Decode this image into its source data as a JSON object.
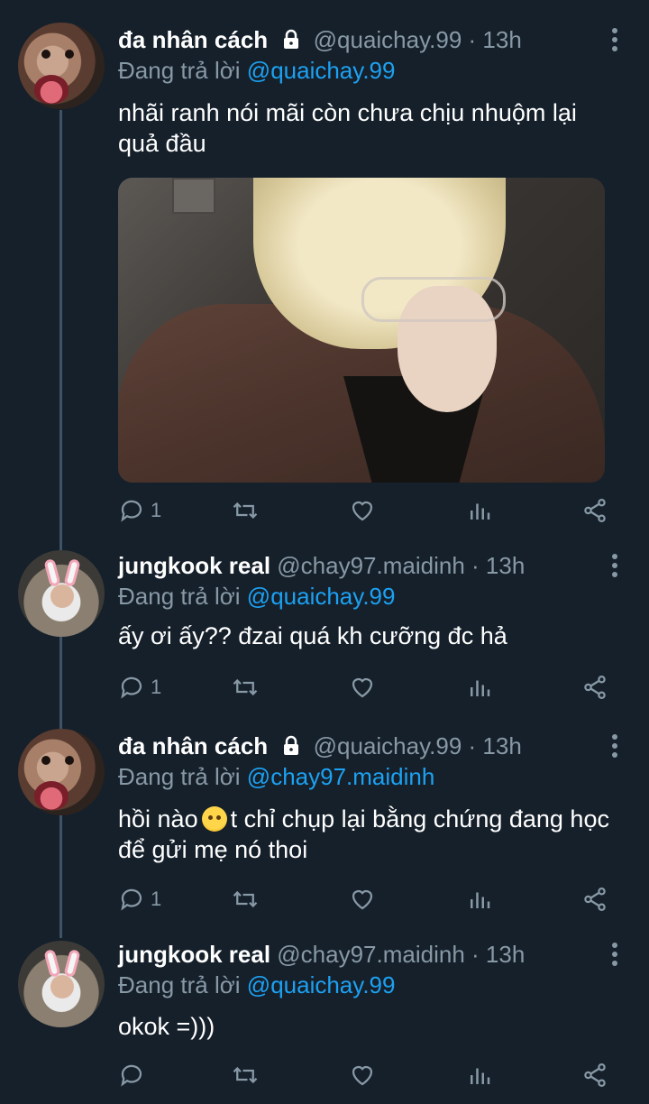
{
  "tweets": [
    {
      "name": "đa nhân cách",
      "locked": true,
      "handle": "@quaichay.99",
      "time": "· 13h",
      "reply_prefix": "Đang trả lời",
      "reply_to": "@quaichay.99",
      "text": "nhãi ranh nói mãi còn chưa chịu nhuộm lại quả đầu",
      "reply_count": "1"
    },
    {
      "name": "jungkook real",
      "locked": false,
      "handle": "@chay97.maidinh",
      "time": "· 13h",
      "reply_prefix": "Đang trả lời",
      "reply_to": "@quaichay.99",
      "text": "ấy ơi ấy?? đzai quá kh cưỡng đc hả",
      "reply_count": "1"
    },
    {
      "name": "đa nhân cách",
      "locked": true,
      "handle": "@quaichay.99",
      "time": "· 13h",
      "reply_prefix": "Đang trả lời",
      "reply_to": "@chay97.maidinh",
      "text_before_emoji": "hồi nào",
      "emoji": "angry-face-emoji",
      "text_after_emoji": "t chỉ chụp lại bằng chứng đang học để gửi mẹ nó thoi",
      "reply_count": "1"
    },
    {
      "name": "jungkook real",
      "locked": false,
      "handle": "@chay97.maidinh",
      "time": "· 13h",
      "reply_prefix": "Đang trả lời",
      "reply_to": "@quaichay.99",
      "text": "okok =)))",
      "reply_count": ""
    }
  ],
  "icons": {
    "reply": "reply-icon",
    "retweet": "retweet-icon",
    "like": "heart-icon",
    "analytics": "analytics-icon",
    "share": "share-icon",
    "more": "more-vertical-icon",
    "lock": "lock-icon"
  },
  "colors": {
    "background": "#15202b",
    "secondary_text": "#8899a6",
    "mention": "#1da1f2",
    "thread_line": "#3d5466"
  }
}
